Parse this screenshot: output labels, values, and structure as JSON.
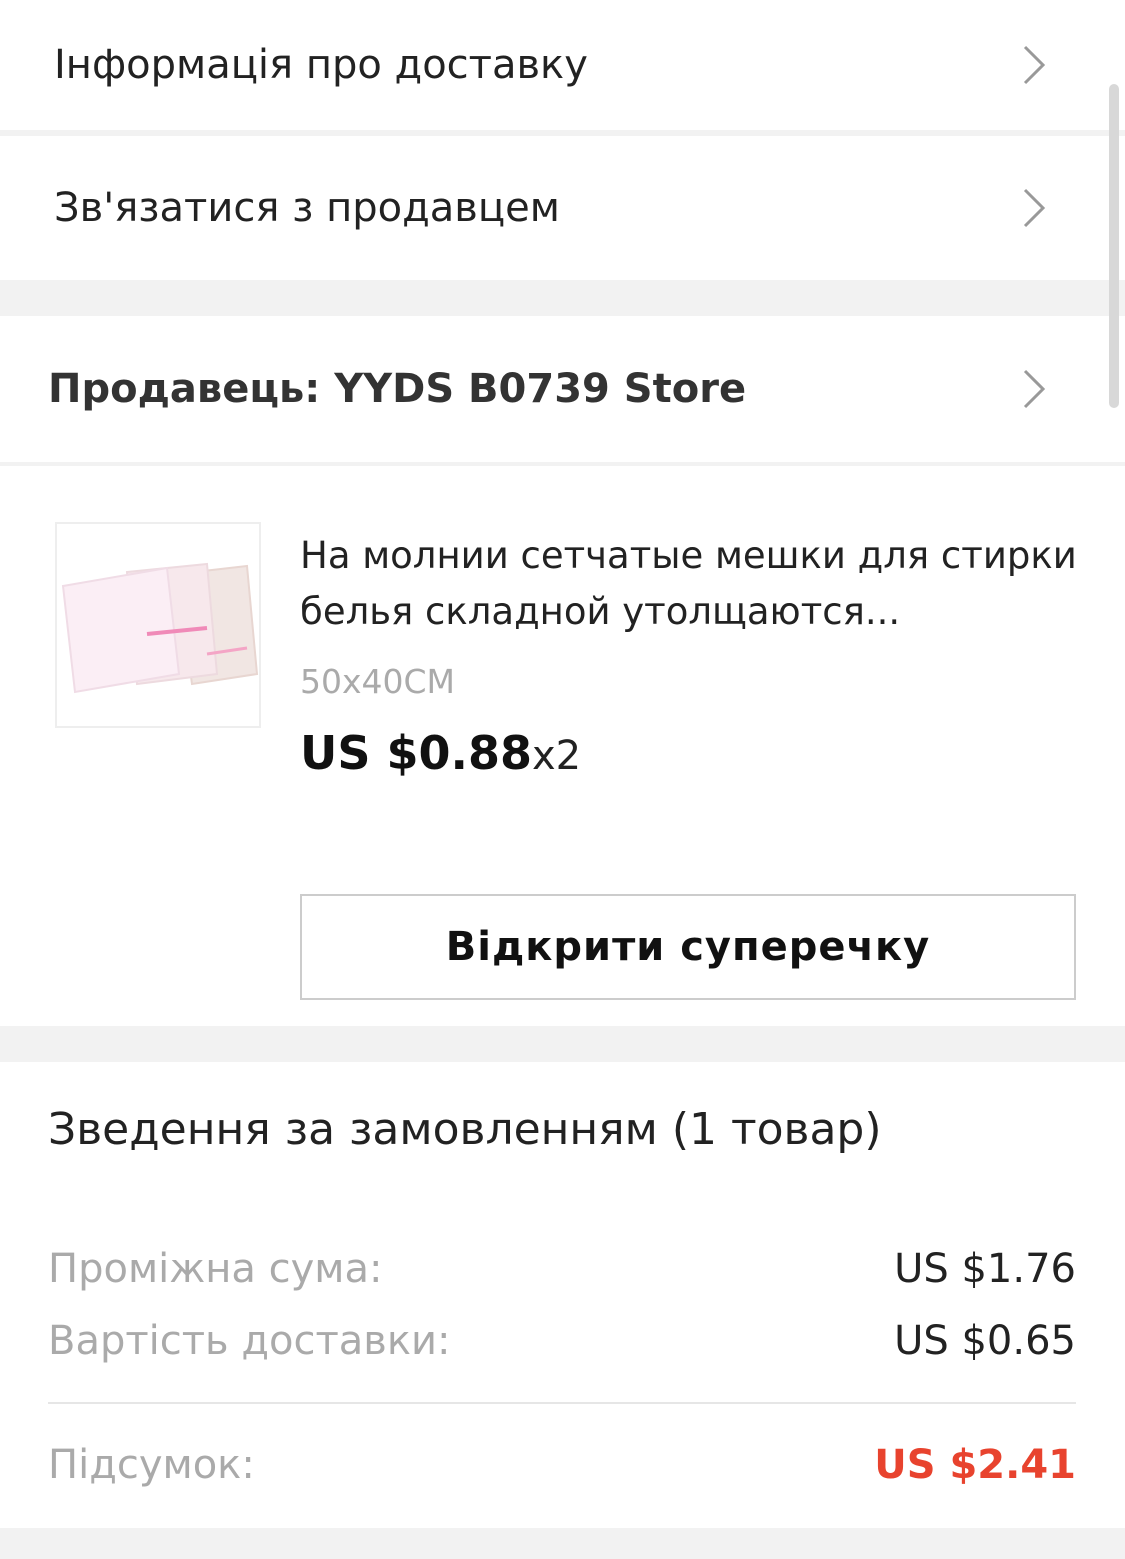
{
  "rows": {
    "delivery_info": "Інформація про доставку",
    "contact_seller": "Зв'язатися з продавцем",
    "seller": "Продавець: YYDS B0739 Store"
  },
  "product": {
    "title": "На молнии сетчатые мешки для стирки белья складной утолщаются...",
    "variant": "50x40CM",
    "price": "US $0.88",
    "quantity": "x2",
    "dispute_button": "Відкрити суперечку"
  },
  "summary": {
    "title": "Зведення за замовленням (1 товар)",
    "subtotal_label": "Проміжна сума:",
    "subtotal_value": "US $1.76",
    "shipping_label": "Вартість доставки:",
    "shipping_value": "US $0.65",
    "total_label": "Підсумок:",
    "total_value": "US $2.41"
  },
  "colors": {
    "accent_total": "#e8432e"
  },
  "icons": {
    "row_chevron": "chevron-right-icon"
  }
}
